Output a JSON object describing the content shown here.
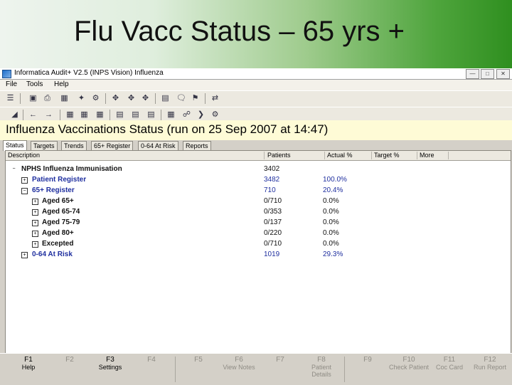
{
  "slide": {
    "title": "Flu Vacc Status – 65 yrs +"
  },
  "window": {
    "title": "Informatica Audit+ V2.5 (INPS Vision)  Influenza"
  },
  "menu": [
    "File",
    "Tools",
    "Help"
  ],
  "report": {
    "title": "Influenza Vaccinations Status (run on 25 Sep 2007 at 14:47)"
  },
  "tabs": [
    "Status",
    "Targets",
    "Trends",
    "65+ Register",
    "0-64 At Risk",
    "Reports"
  ],
  "columns": [
    "Description",
    "Patients",
    "Actual %",
    "Target %",
    "More"
  ],
  "rows": [
    {
      "expander": "−",
      "label": "NPHS Influenza Immunisation",
      "patients": "3402",
      "actual": ""
    },
    {
      "expander": "+",
      "label": "Patient Register",
      "patients": "3482",
      "actual": "100.0%"
    },
    {
      "expander": "−",
      "label": "65+ Register",
      "patients": "710",
      "actual": "20.4%"
    },
    {
      "expander": "+",
      "label": "Aged 65+",
      "patients": "0/710",
      "actual": "0.0%"
    },
    {
      "expander": "+",
      "label": "Aged 65-74",
      "patients": "0/353",
      "actual": "0.0%"
    },
    {
      "expander": "+",
      "label": "Aged 75-79",
      "patients": "0/137",
      "actual": "0.0%"
    },
    {
      "expander": "+",
      "label": "Aged 80+",
      "patients": "0/220",
      "actual": "0.0%"
    },
    {
      "expander": "+",
      "label": "Excepted",
      "patients": "0/710",
      "actual": "0.0%"
    },
    {
      "expander": "+",
      "label": "0-64 At Risk",
      "patients": "1019",
      "actual": "29.3%"
    }
  ],
  "fkeys": [
    {
      "code": "F1",
      "label": "Help"
    },
    {
      "code": "F2",
      "label": ""
    },
    {
      "code": "F3",
      "label": "Settings"
    },
    {
      "code": "F4",
      "label": ""
    },
    {
      "code": "F5",
      "label": ""
    },
    {
      "code": "F6",
      "label": "View Notes"
    },
    {
      "code": "F7",
      "label": ""
    },
    {
      "code": "F8",
      "label": "Patient Details"
    },
    {
      "code": "F9",
      "label": ""
    },
    {
      "code": "F10",
      "label": "Check Patient"
    },
    {
      "code": "F11",
      "label": "Coc Card"
    },
    {
      "code": "F12",
      "label": "Run Report"
    }
  ],
  "colors": {
    "accent_green": "#4fa53d",
    "row_blue": "#1f2f9f",
    "title_bar_yellow": "#fefbd6"
  }
}
